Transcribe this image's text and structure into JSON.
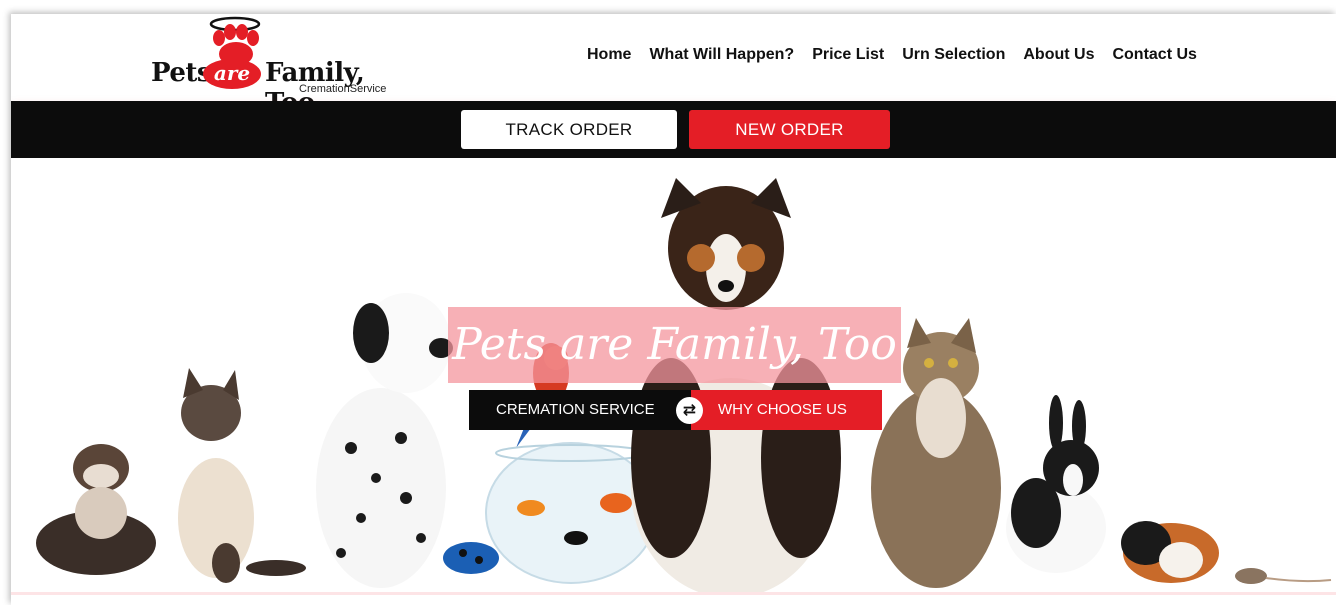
{
  "logo": {
    "word_pets": "Pets",
    "word_are": "are",
    "word_family": "Family, Too",
    "subtitle": "CremationService"
  },
  "nav": {
    "items": [
      {
        "label": "Home"
      },
      {
        "label": "What Will Happen?"
      },
      {
        "label": "Price List"
      },
      {
        "label": "Urn Selection"
      },
      {
        "label": "About Us"
      },
      {
        "label": "Contact Us"
      }
    ]
  },
  "order_bar": {
    "track_label": "TRACK ORDER",
    "new_label": "NEW ORDER"
  },
  "hero": {
    "tagline": "Pets are Family, Too",
    "cta_left": "CREMATION SERVICE",
    "cta_right": "WHY CHOOSE US",
    "swap_icon": "swap-arrows-icon"
  },
  "colors": {
    "brand_red": "#e41e26",
    "bar_black": "#0c0c0c",
    "tagline_pink": "#f4969e"
  }
}
